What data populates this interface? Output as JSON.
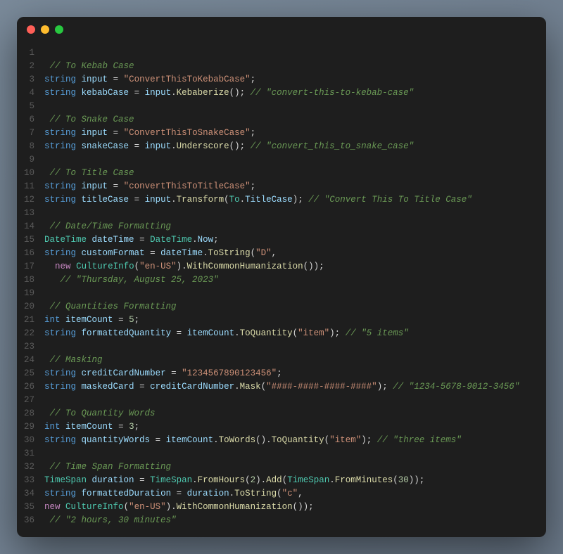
{
  "window": {
    "traffic_lights": [
      "close",
      "minimize",
      "zoom"
    ]
  },
  "code": {
    "lines": [
      {
        "n": 1,
        "tokens": []
      },
      {
        "n": 2,
        "tokens": [
          [
            "c-comment",
            " // To Kebab Case"
          ]
        ]
      },
      {
        "n": 3,
        "tokens": [
          [
            "",
            ""
          ],
          [
            "c-type",
            "string"
          ],
          [
            "",
            " "
          ],
          [
            "c-var",
            "input"
          ],
          [
            "c-op",
            " = "
          ],
          [
            "c-string",
            "\"ConvertThisToKebabCase\""
          ],
          [
            "c-punct",
            ";"
          ]
        ]
      },
      {
        "n": 4,
        "tokens": [
          [
            "",
            ""
          ],
          [
            "c-type",
            "string"
          ],
          [
            "",
            " "
          ],
          [
            "c-var",
            "kebabCase"
          ],
          [
            "c-op",
            " = "
          ],
          [
            "c-var",
            "input"
          ],
          [
            "c-punct",
            "."
          ],
          [
            "c-func",
            "Kebaberize"
          ],
          [
            "c-punct",
            "(); "
          ],
          [
            "c-comment",
            "// \"convert-this-to-kebab-case\""
          ]
        ]
      },
      {
        "n": 5,
        "tokens": []
      },
      {
        "n": 6,
        "tokens": [
          [
            "c-comment",
            " // To Snake Case"
          ]
        ]
      },
      {
        "n": 7,
        "tokens": [
          [
            "",
            ""
          ],
          [
            "c-type",
            "string"
          ],
          [
            "",
            " "
          ],
          [
            "c-var",
            "input"
          ],
          [
            "c-op",
            " = "
          ],
          [
            "c-string",
            "\"ConvertThisToSnakeCase\""
          ],
          [
            "c-punct",
            ";"
          ]
        ]
      },
      {
        "n": 8,
        "tokens": [
          [
            "",
            ""
          ],
          [
            "c-type",
            "string"
          ],
          [
            "",
            " "
          ],
          [
            "c-var",
            "snakeCase"
          ],
          [
            "c-op",
            " = "
          ],
          [
            "c-var",
            "input"
          ],
          [
            "c-punct",
            "."
          ],
          [
            "c-func",
            "Underscore"
          ],
          [
            "c-punct",
            "(); "
          ],
          [
            "c-comment",
            "// \"convert_this_to_snake_case\""
          ]
        ]
      },
      {
        "n": 9,
        "tokens": []
      },
      {
        "n": 10,
        "tokens": [
          [
            "c-comment",
            " // To Title Case"
          ]
        ]
      },
      {
        "n": 11,
        "tokens": [
          [
            "",
            ""
          ],
          [
            "c-type",
            "string"
          ],
          [
            "",
            " "
          ],
          [
            "c-var",
            "input"
          ],
          [
            "c-op",
            " = "
          ],
          [
            "c-string",
            "\"convertThisToTitleCase\""
          ],
          [
            "c-punct",
            ";"
          ]
        ]
      },
      {
        "n": 12,
        "tokens": [
          [
            "",
            ""
          ],
          [
            "c-type",
            "string"
          ],
          [
            "",
            " "
          ],
          [
            "c-var",
            "titleCase"
          ],
          [
            "c-op",
            " = "
          ],
          [
            "c-var",
            "input"
          ],
          [
            "c-punct",
            "."
          ],
          [
            "c-func",
            "Transform"
          ],
          [
            "c-punct",
            "("
          ],
          [
            "c-class",
            "To"
          ],
          [
            "c-punct",
            "."
          ],
          [
            "c-var",
            "TitleCase"
          ],
          [
            "c-punct",
            "); "
          ],
          [
            "c-comment",
            "// \"Convert This To Title Case\""
          ]
        ]
      },
      {
        "n": 13,
        "tokens": []
      },
      {
        "n": 14,
        "tokens": [
          [
            "c-comment",
            " // Date/Time Formatting"
          ]
        ]
      },
      {
        "n": 15,
        "tokens": [
          [
            "",
            ""
          ],
          [
            "c-class",
            "DateTime"
          ],
          [
            "",
            " "
          ],
          [
            "c-var",
            "dateTime"
          ],
          [
            "c-op",
            " = "
          ],
          [
            "c-class",
            "DateTime"
          ],
          [
            "c-punct",
            "."
          ],
          [
            "c-var",
            "Now"
          ],
          [
            "c-punct",
            ";"
          ]
        ]
      },
      {
        "n": 16,
        "tokens": [
          [
            "",
            ""
          ],
          [
            "c-type",
            "string"
          ],
          [
            "",
            " "
          ],
          [
            "c-var",
            "customFormat"
          ],
          [
            "c-op",
            " = "
          ],
          [
            "c-var",
            "dateTime"
          ],
          [
            "c-punct",
            "."
          ],
          [
            "c-func",
            "ToString"
          ],
          [
            "c-punct",
            "("
          ],
          [
            "c-string",
            "\"D\""
          ],
          [
            "c-punct",
            ","
          ]
        ]
      },
      {
        "n": 17,
        "tokens": [
          [
            "",
            "  "
          ],
          [
            "c-keyword",
            "new"
          ],
          [
            "",
            " "
          ],
          [
            "c-class",
            "CultureInfo"
          ],
          [
            "c-punct",
            "("
          ],
          [
            "c-string",
            "\"en-US\""
          ],
          [
            "c-punct",
            ")."
          ],
          [
            "c-func",
            "WithCommonHumanization"
          ],
          [
            "c-punct",
            "());"
          ]
        ]
      },
      {
        "n": 18,
        "tokens": [
          [
            "",
            "   "
          ],
          [
            "c-comment",
            "// \"Thursday, August 25, 2023\""
          ]
        ]
      },
      {
        "n": 19,
        "tokens": []
      },
      {
        "n": 20,
        "tokens": [
          [
            "c-comment",
            " // Quantities Formatting"
          ]
        ]
      },
      {
        "n": 21,
        "tokens": [
          [
            "",
            ""
          ],
          [
            "c-type",
            "int"
          ],
          [
            "",
            " "
          ],
          [
            "c-var",
            "itemCount"
          ],
          [
            "c-op",
            " = "
          ],
          [
            "c-num",
            "5"
          ],
          [
            "c-punct",
            ";"
          ]
        ]
      },
      {
        "n": 22,
        "tokens": [
          [
            "",
            ""
          ],
          [
            "c-type",
            "string"
          ],
          [
            "",
            " "
          ],
          [
            "c-var",
            "formattedQuantity"
          ],
          [
            "c-op",
            " = "
          ],
          [
            "c-var",
            "itemCount"
          ],
          [
            "c-punct",
            "."
          ],
          [
            "c-func",
            "ToQuantity"
          ],
          [
            "c-punct",
            "("
          ],
          [
            "c-string",
            "\"item\""
          ],
          [
            "c-punct",
            "); "
          ],
          [
            "c-comment",
            "// \"5 items\""
          ]
        ]
      },
      {
        "n": 23,
        "tokens": []
      },
      {
        "n": 24,
        "tokens": [
          [
            "c-comment",
            " // Masking"
          ]
        ]
      },
      {
        "n": 25,
        "tokens": [
          [
            "",
            ""
          ],
          [
            "c-type",
            "string"
          ],
          [
            "",
            " "
          ],
          [
            "c-var",
            "creditCardNumber"
          ],
          [
            "c-op",
            " = "
          ],
          [
            "c-string",
            "\"1234567890123456\""
          ],
          [
            "c-punct",
            ";"
          ]
        ]
      },
      {
        "n": 26,
        "tokens": [
          [
            "",
            ""
          ],
          [
            "c-type",
            "string"
          ],
          [
            "",
            " "
          ],
          [
            "c-var",
            "maskedCard"
          ],
          [
            "c-op",
            " = "
          ],
          [
            "c-var",
            "creditCardNumber"
          ],
          [
            "c-punct",
            "."
          ],
          [
            "c-func",
            "Mask"
          ],
          [
            "c-punct",
            "("
          ],
          [
            "c-string",
            "\"####-####-####-####\""
          ],
          [
            "c-punct",
            "); "
          ],
          [
            "c-comment",
            "// \"1234-5678-9012-3456\""
          ]
        ]
      },
      {
        "n": 27,
        "tokens": []
      },
      {
        "n": 28,
        "tokens": [
          [
            "c-comment",
            " // To Quantity Words"
          ]
        ]
      },
      {
        "n": 29,
        "tokens": [
          [
            "",
            ""
          ],
          [
            "c-type",
            "int"
          ],
          [
            "",
            " "
          ],
          [
            "c-var",
            "itemCount"
          ],
          [
            "c-op",
            " = "
          ],
          [
            "c-num",
            "3"
          ],
          [
            "c-punct",
            ";"
          ]
        ]
      },
      {
        "n": 30,
        "tokens": [
          [
            "",
            ""
          ],
          [
            "c-type",
            "string"
          ],
          [
            "",
            " "
          ],
          [
            "c-var",
            "quantityWords"
          ],
          [
            "c-op",
            " = "
          ],
          [
            "c-var",
            "itemCount"
          ],
          [
            "c-punct",
            "."
          ],
          [
            "c-func",
            "ToWords"
          ],
          [
            "c-punct",
            "()."
          ],
          [
            "c-func",
            "ToQuantity"
          ],
          [
            "c-punct",
            "("
          ],
          [
            "c-string",
            "\"item\""
          ],
          [
            "c-punct",
            "); "
          ],
          [
            "c-comment",
            "// \"three items\""
          ]
        ]
      },
      {
        "n": 31,
        "tokens": []
      },
      {
        "n": 32,
        "tokens": [
          [
            "c-comment",
            " // Time Span Formatting"
          ]
        ]
      },
      {
        "n": 33,
        "tokens": [
          [
            "",
            ""
          ],
          [
            "c-class",
            "TimeSpan"
          ],
          [
            "",
            " "
          ],
          [
            "c-var",
            "duration"
          ],
          [
            "c-op",
            " = "
          ],
          [
            "c-class",
            "TimeSpan"
          ],
          [
            "c-punct",
            "."
          ],
          [
            "c-func",
            "FromHours"
          ],
          [
            "c-punct",
            "("
          ],
          [
            "c-num",
            "2"
          ],
          [
            "c-punct",
            ")."
          ],
          [
            "c-func",
            "Add"
          ],
          [
            "c-punct",
            "("
          ],
          [
            "c-class",
            "TimeSpan"
          ],
          [
            "c-punct",
            "."
          ],
          [
            "c-func",
            "FromMinutes"
          ],
          [
            "c-punct",
            "("
          ],
          [
            "c-num",
            "30"
          ],
          [
            "c-punct",
            "));"
          ]
        ]
      },
      {
        "n": 34,
        "tokens": [
          [
            "",
            ""
          ],
          [
            "c-type",
            "string"
          ],
          [
            "",
            " "
          ],
          [
            "c-var",
            "formattedDuration"
          ],
          [
            "c-op",
            " = "
          ],
          [
            "c-var",
            "duration"
          ],
          [
            "c-punct",
            "."
          ],
          [
            "c-func",
            "ToString"
          ],
          [
            "c-punct",
            "("
          ],
          [
            "c-string",
            "\"c\""
          ],
          [
            "c-punct",
            ","
          ]
        ]
      },
      {
        "n": 35,
        "tokens": [
          [
            "",
            ""
          ],
          [
            "c-keyword",
            "new"
          ],
          [
            "",
            " "
          ],
          [
            "c-class",
            "CultureInfo"
          ],
          [
            "c-punct",
            "("
          ],
          [
            "c-string",
            "\"en-US\""
          ],
          [
            "c-punct",
            ")."
          ],
          [
            "c-func",
            "WithCommonHumanization"
          ],
          [
            "c-punct",
            "());"
          ]
        ]
      },
      {
        "n": 36,
        "tokens": [
          [
            "c-comment",
            " // \"2 hours, 30 minutes\""
          ]
        ]
      }
    ]
  }
}
